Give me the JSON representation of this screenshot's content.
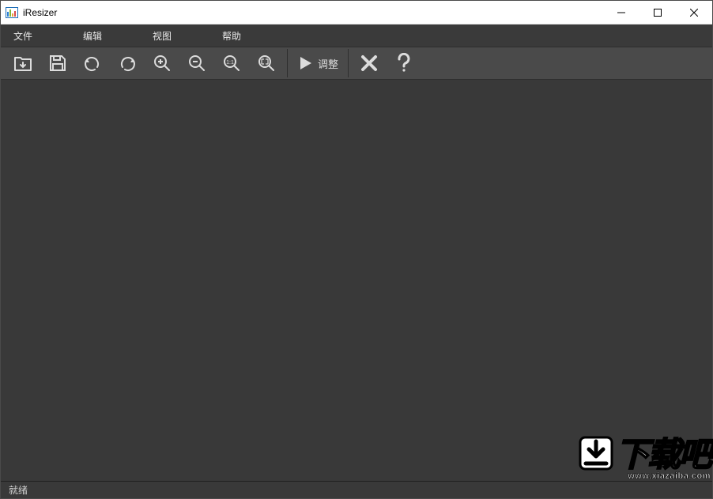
{
  "app": {
    "title": "iResizer"
  },
  "menu": {
    "file": "文件",
    "edit": "编辑",
    "view": "视图",
    "help": "帮助"
  },
  "toolbar": {
    "adjust_label": "调整"
  },
  "status": {
    "text": "就绪"
  },
  "watermark": {
    "text": "下载吧",
    "url": "www.xiazaiba.com"
  }
}
